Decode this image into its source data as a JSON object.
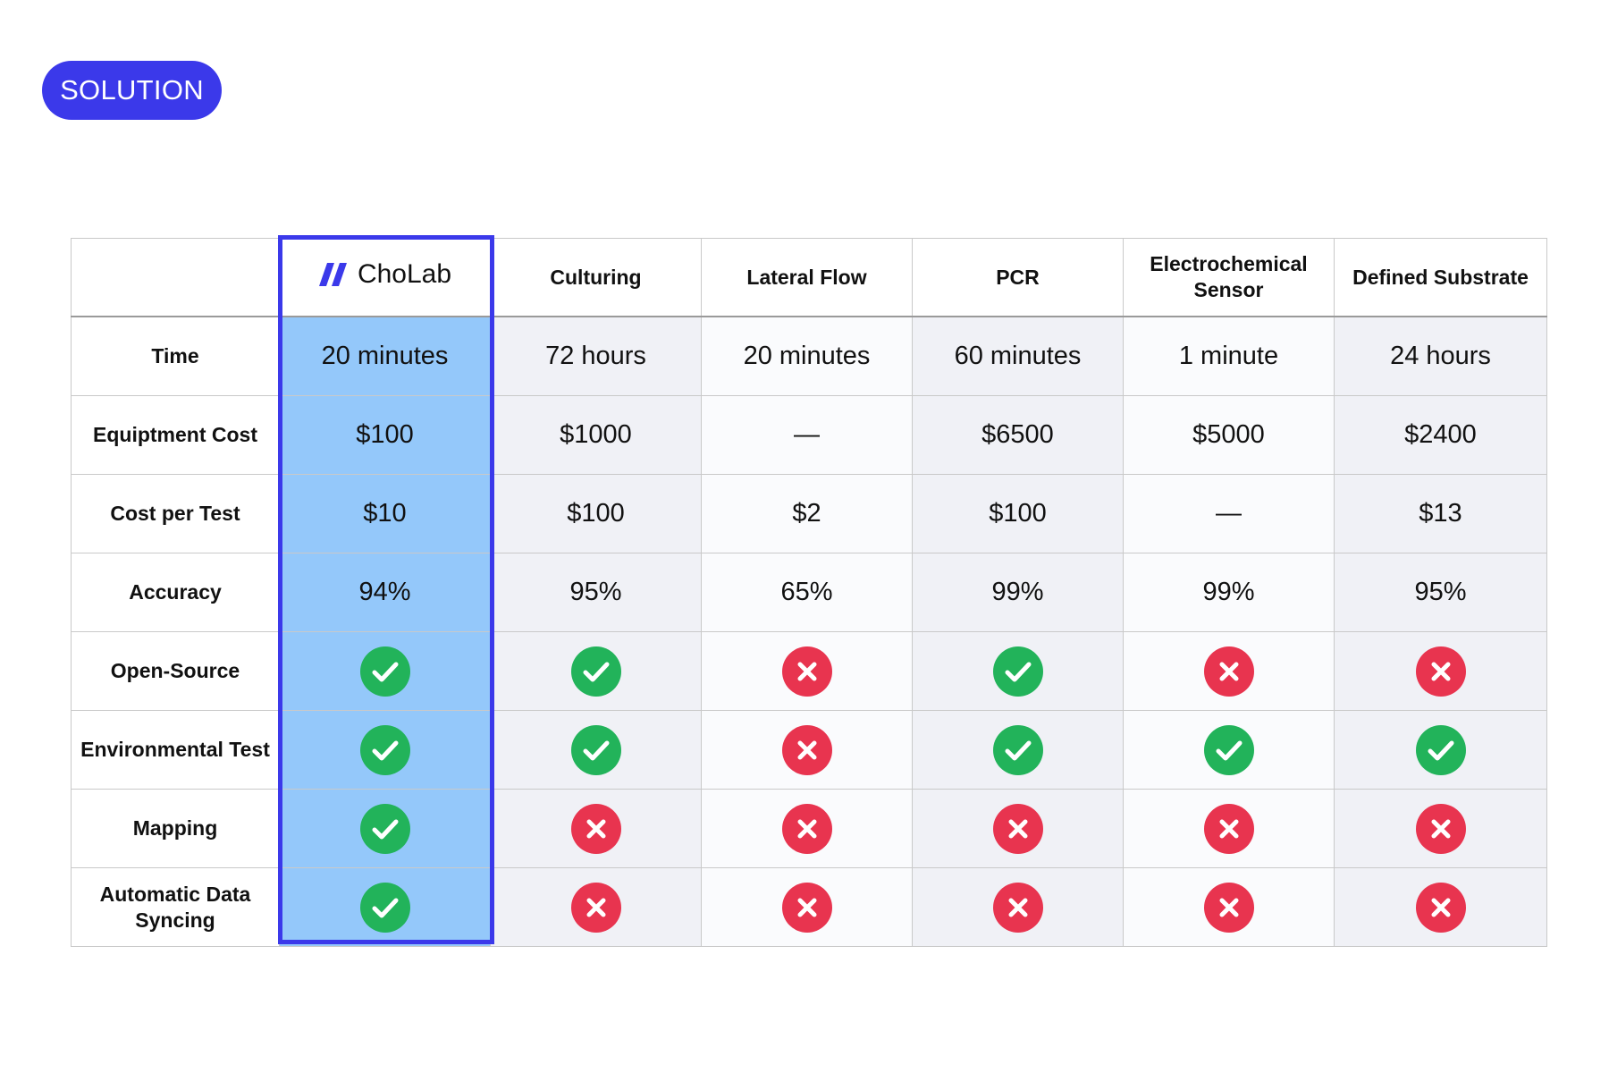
{
  "badge_label": "SOLUTION",
  "colors": {
    "accent": "#3b39ea",
    "highlight": "#94c8fa",
    "check": "#22b35a",
    "cross": "#e8344f"
  },
  "table": {
    "columns": [
      {
        "label": "",
        "logo": false
      },
      {
        "label": "ChoLab",
        "logo": true,
        "logo_icon": "cholab-logo-icon"
      },
      {
        "label": "Culturing"
      },
      {
        "label": "Lateral Flow"
      },
      {
        "label": "PCR"
      },
      {
        "label": "Electrochemical Sensor"
      },
      {
        "label": "Defined Substrate"
      }
    ],
    "rows": [
      {
        "label": "Time",
        "cells": [
          {
            "text": "20 minutes"
          },
          {
            "text": "72 hours"
          },
          {
            "text": "20 minutes"
          },
          {
            "text": "60 minutes"
          },
          {
            "text": "1 minute"
          },
          {
            "text": "24 hours"
          }
        ]
      },
      {
        "label": "Equiptment Cost",
        "cells": [
          {
            "text": "$100"
          },
          {
            "text": "$1000"
          },
          {
            "text": "—"
          },
          {
            "text": "$6500"
          },
          {
            "text": "$5000"
          },
          {
            "text": "$2400"
          }
        ]
      },
      {
        "label": "Cost per Test",
        "cells": [
          {
            "text": "$10"
          },
          {
            "text": "$100"
          },
          {
            "text": "$2"
          },
          {
            "text": "$100"
          },
          {
            "text": "—"
          },
          {
            "text": "$13"
          }
        ]
      },
      {
        "label": "Accuracy",
        "cells": [
          {
            "text": "94%"
          },
          {
            "text": "95%"
          },
          {
            "text": "65%"
          },
          {
            "text": "99%"
          },
          {
            "text": "99%"
          },
          {
            "text": "95%"
          }
        ]
      },
      {
        "label": "Open-Source",
        "cells": [
          {
            "icon": "check-icon"
          },
          {
            "icon": "check-icon"
          },
          {
            "icon": "cross-icon"
          },
          {
            "icon": "check-icon"
          },
          {
            "icon": "cross-icon"
          },
          {
            "icon": "cross-icon"
          }
        ]
      },
      {
        "label": "Environmental Test",
        "cells": [
          {
            "icon": "check-icon"
          },
          {
            "icon": "check-icon"
          },
          {
            "icon": "cross-icon"
          },
          {
            "icon": "check-icon"
          },
          {
            "icon": "check-icon"
          },
          {
            "icon": "check-icon"
          }
        ]
      },
      {
        "label": "Mapping",
        "cells": [
          {
            "icon": "check-icon"
          },
          {
            "icon": "cross-icon"
          },
          {
            "icon": "cross-icon"
          },
          {
            "icon": "cross-icon"
          },
          {
            "icon": "cross-icon"
          },
          {
            "icon": "cross-icon"
          }
        ]
      },
      {
        "label": "Automatic Data Syncing",
        "cells": [
          {
            "icon": "check-icon"
          },
          {
            "icon": "cross-icon"
          },
          {
            "icon": "cross-icon"
          },
          {
            "icon": "cross-icon"
          },
          {
            "icon": "cross-icon"
          },
          {
            "icon": "cross-icon"
          }
        ]
      }
    ]
  }
}
